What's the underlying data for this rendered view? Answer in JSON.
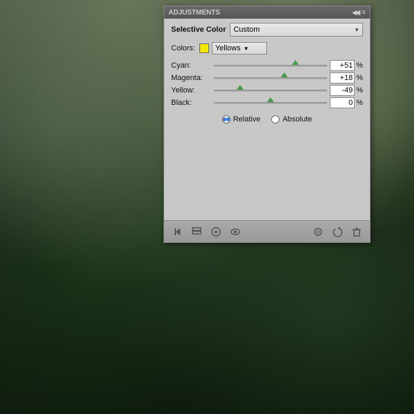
{
  "panel": {
    "titlebar": {
      "label": "ADJUSTMENTS",
      "collapse_icon": "◀◀",
      "menu_icon": "≡"
    },
    "header": {
      "label": "Selective Color",
      "preset_label": "Custom"
    },
    "colors_row": {
      "label": "Colors:",
      "color_name": "Yellows"
    },
    "sliders": [
      {
        "label": "Cyan:",
        "value": "+51",
        "pct": "%",
        "thumb_pct": 72
      },
      {
        "label": "Magenta:",
        "value": "+18",
        "pct": "%",
        "thumb_pct": 62
      },
      {
        "label": "Yellow:",
        "value": "-49",
        "pct": "%",
        "thumb_pct": 23
      },
      {
        "label": "Black:",
        "value": "0",
        "pct": "%",
        "thumb_pct": 50
      }
    ],
    "radio": {
      "option1": "Relative",
      "option2": "Absolute",
      "selected": "Relative"
    },
    "toolbar": {
      "left_icons": [
        "⬅",
        "◫",
        "⦿",
        "👁"
      ],
      "right_icons": [
        "◉",
        "↺",
        "⊡"
      ]
    }
  }
}
